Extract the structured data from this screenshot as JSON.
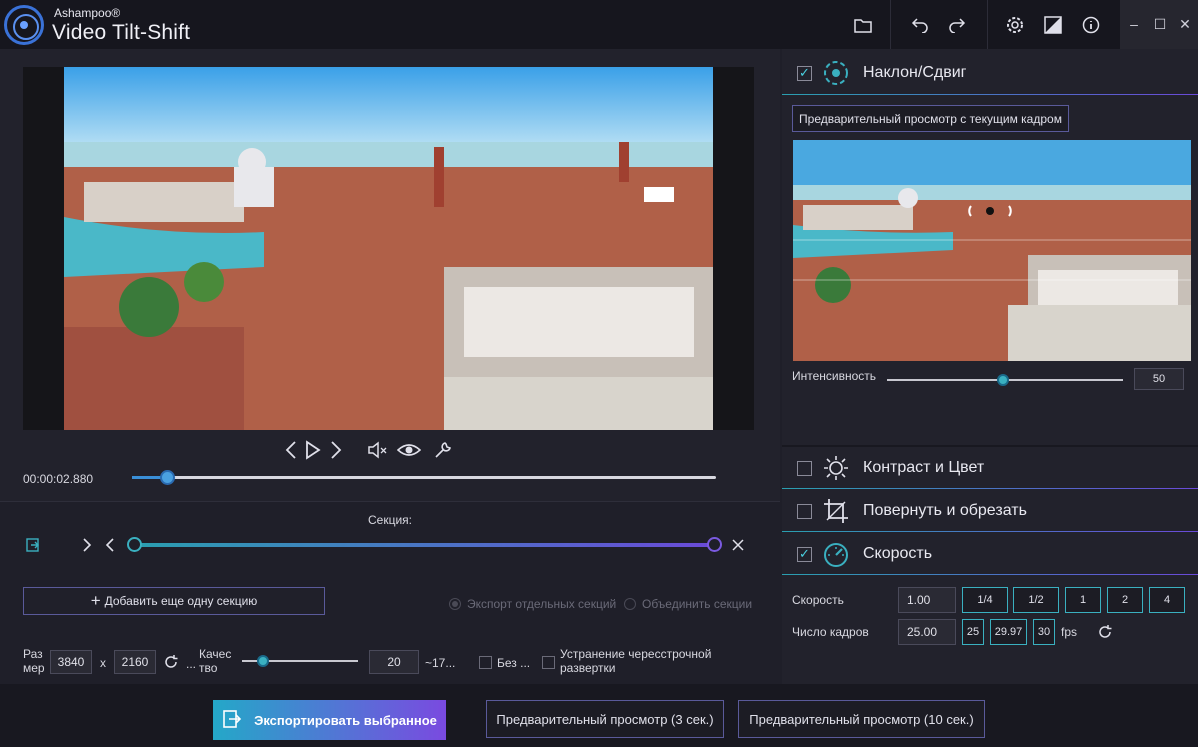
{
  "app": {
    "brand": "Ashampoo®",
    "product": "Video Tilt-Shift"
  },
  "toolbar": {
    "icons": [
      "folder-icon",
      "undo-icon",
      "redo-icon",
      "gear-icon",
      "compare-icon",
      "info-icon"
    ],
    "window": [
      "minimize-icon",
      "maximize-icon",
      "close-icon"
    ]
  },
  "player": {
    "time": "00:00:02.880",
    "seek_fraction": 0.06
  },
  "section": {
    "label": "Секция:",
    "add_button": "Добавить еще одну секцию",
    "export_separate": "Экспорт отдельных секций",
    "merge": "Объединить секции"
  },
  "output": {
    "size_label": "Раз мер",
    "width": "3840",
    "x_label": "x",
    "height": "2160",
    "ellipsis1": "...",
    "quality_label": "Качес тво",
    "quality_value": "20",
    "approx": "~17...",
    "no_label": "Без ...",
    "deinterlace_label": "Устранение чересстрочной развертки"
  },
  "right": {
    "tilt_title": "Наклон/Сдвиг",
    "preview_button": "Предварительный просмотр с текущим кадром",
    "intensity_label": "Интенсивность",
    "intensity_value": "50",
    "intensity_fraction": 0.49,
    "contrast_title": "Контраст и Цвет",
    "rotate_title": "Повернуть и обрезать",
    "speed_title": "Скорость",
    "speed_label": "Скорость",
    "speed_value": "1.00",
    "speed_buttons": [
      "1/4",
      "1/2",
      "1",
      "2",
      "4"
    ],
    "fps_label": "Число кадров",
    "fps_value": "25.00",
    "fps_buttons": [
      "25",
      "29.97",
      "30"
    ],
    "fps_unit": "fps"
  },
  "bottom": {
    "export_button": "Экспортировать выбранное",
    "preview3": "Предварительный просмотр (3 сек.)",
    "preview10": "Предварительный просмотр (10 сек.)"
  },
  "colors": {
    "accent_start": "#24a8c8",
    "accent_end": "#7a4ae0",
    "background": "#1f1f29"
  }
}
